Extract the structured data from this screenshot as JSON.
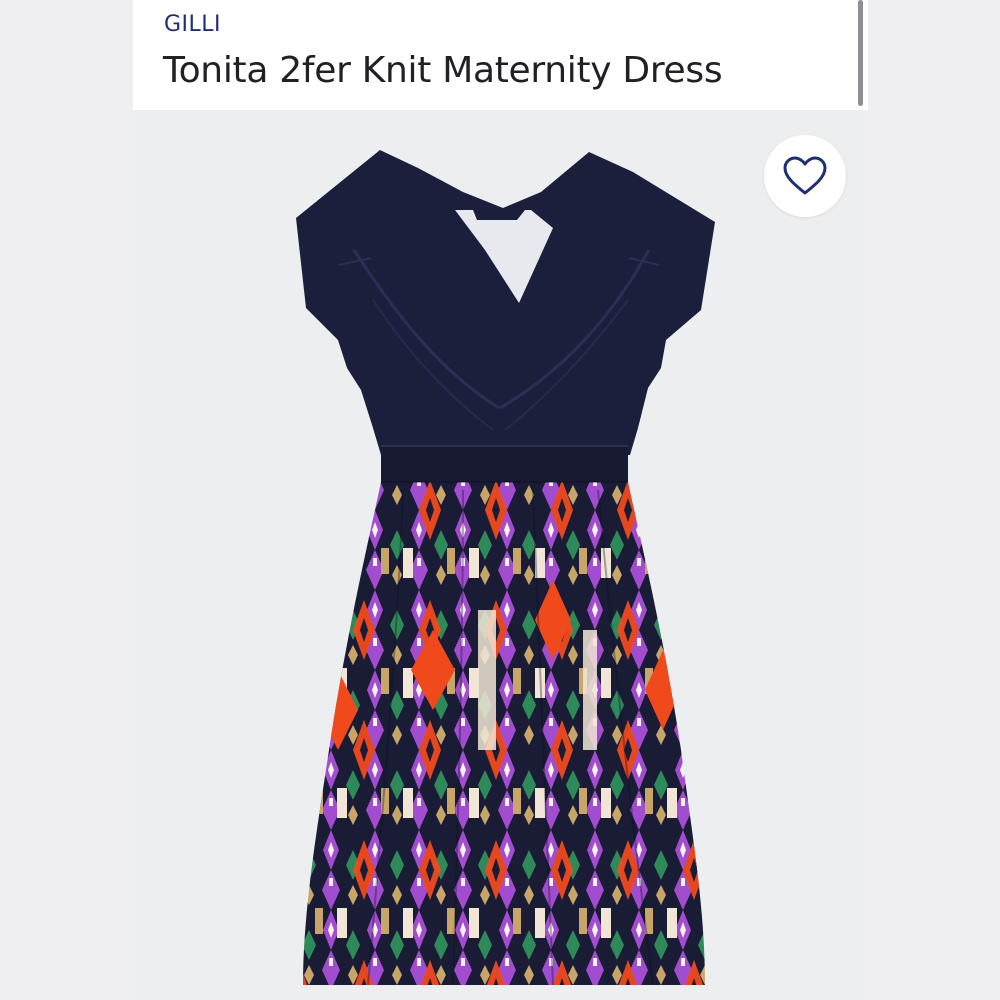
{
  "product": {
    "brand": "GILLI",
    "title": "Tonita 2fer Knit Maternity Dress",
    "image_alt": "dress-product-photo"
  },
  "favorite": {
    "icon": "heart-outline-icon"
  },
  "colors": {
    "brand_text": "#1f2f72",
    "heart": "#1f2f72",
    "dress_top": "#1c1f3c",
    "pattern_purple": "#a24ccf",
    "pattern_orange": "#f04a1c",
    "pattern_green": "#2f8a5a",
    "pattern_tan": "#c8a66a"
  }
}
